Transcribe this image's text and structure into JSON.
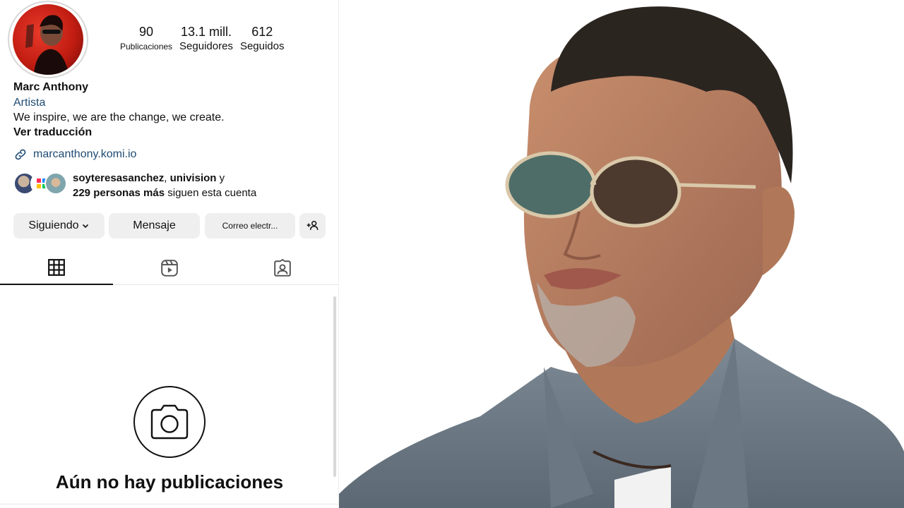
{
  "profile": {
    "stats": [
      {
        "value": "90",
        "label": "Publicaciones"
      },
      {
        "value": "13.1 mill.",
        "label": "Seguidores"
      },
      {
        "value": "612",
        "label": "Seguidos"
      }
    ],
    "name": "Marc Anthony",
    "category": "Artista",
    "bio": "We inspire, we are the change, we create.",
    "translate": "Ver traducción",
    "link": "marcanthony.komi.io",
    "followed_by": {
      "names_bold": "soyteresasanchez",
      "separator": ", ",
      "names_bold2": "univision",
      "conjunction": " y",
      "count_bold": "229 personas más",
      "suffix": " siguen esta cuenta"
    }
  },
  "buttons": {
    "following": "Siguiendo",
    "message": "Mensaje",
    "email": "Correo electr..."
  },
  "tabs": [
    {
      "icon": "grid-icon"
    },
    {
      "icon": "reels-icon"
    },
    {
      "icon": "tagged-icon"
    }
  ],
  "empty_state": {
    "icon": "camera-icon",
    "title": "Aún no hay publicaciones"
  },
  "colors": {
    "link": "#1f4b73",
    "button_bg": "#efefef",
    "avatar_red": "#c21d12"
  }
}
